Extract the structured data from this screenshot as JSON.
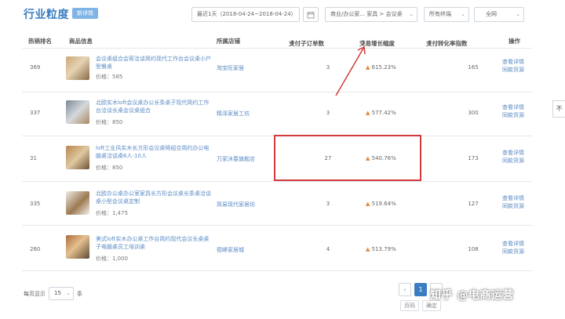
{
  "header": {
    "title": "行业粒度",
    "badge": "新详情",
    "date_range": "最近1天（2018-04-24~2018-04-24）",
    "category": "商业/办公家... 家具 > 会议桌",
    "terminal": "所有终端",
    "network": "全网",
    "calendar_icon": "calendar-icon"
  },
  "table": {
    "columns": [
      {
        "label": "热销排名"
      },
      {
        "label": "商品信息"
      },
      {
        "label": "所属店铺"
      },
      {
        "label": "支付子订单数",
        "sort": "⇕"
      },
      {
        "label": "交易增长幅度",
        "sort": "⇕"
      },
      {
        "label": "支付转化率指数",
        "sort": "⇕"
      },
      {
        "label": "操作"
      }
    ],
    "rows": [
      {
        "rank": "369",
        "title": "会议桌组合会客洽谈简约现代工作台会议桌小户型餐桌",
        "price": "价格：585",
        "shop": "淘宝旺家居",
        "orders": "3",
        "growth": "615.23%",
        "conv": "165",
        "op1": "查看详情",
        "op2": "同款货源"
      },
      {
        "rank": "337",
        "title": "北欧实木loft会议桌办公长条桌子现代简约工作台洽谈长桌会议桌组合",
        "price": "价格：850",
        "shop": "精泽家居工坊",
        "orders": "3",
        "growth": "577.42%",
        "conv": "300",
        "op1": "查看详情",
        "op2": "同款货源"
      },
      {
        "rank": "31",
        "title": "loft工业风实木长方形会议桌椅组合简约办公电脑桌洽谈桌6人-10人",
        "price": "价格：850",
        "shop": "万家沐春旗舰店",
        "orders": "27",
        "growth": "540.76%",
        "conv": "173",
        "op1": "查看详情",
        "op2": "同款货源"
      },
      {
        "rank": "335",
        "title": "北欧办公桌办公室家具长方形会议桌长条桌洽谈桌小型会议桌定制",
        "price": "价格：1,475",
        "shop": "简易现代家居坊",
        "orders": "3",
        "growth": "519.64%",
        "conv": "127",
        "op1": "查看详情",
        "op2": "同款货源"
      },
      {
        "rank": "260",
        "title": "美式loft实木办公桌工作台简约现代会议长桌桌子电脑桌员工培训桌",
        "price": "价格：1,000",
        "shop": "德峰家居城",
        "orders": "4",
        "growth": "513.79%",
        "conv": "108",
        "op1": "查看详情",
        "op2": "同款货源"
      }
    ],
    "growth_up_icon": "arrow-up-icon"
  },
  "footer": {
    "per_page_label": "每页显示",
    "per_page_value": "15",
    "per_page_unit": "条",
    "prev": "‹",
    "page": "1",
    "next": "›",
    "page_label": "页码",
    "confirm": "确定"
  },
  "watermark": "知乎 @电商运营",
  "side_tab": "不",
  "colors": {
    "accent": "#3a7dc2",
    "highlight": "#d23b3b",
    "growth": "#e2863a"
  }
}
